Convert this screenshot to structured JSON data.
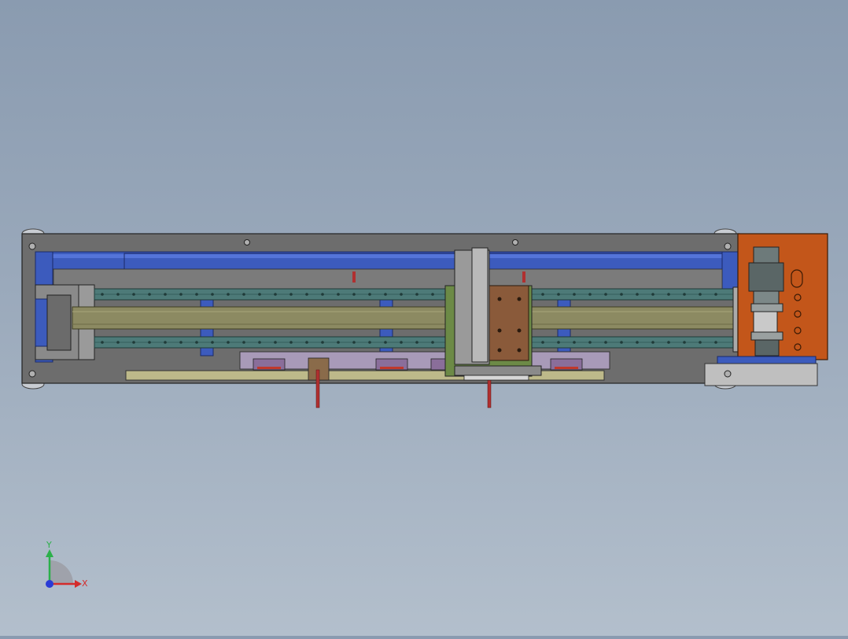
{
  "app": {
    "view": "cad-3d-assembly-front-view"
  },
  "colors": {
    "background_top": "#8a9bb0",
    "background_bottom": "#b3bfcc",
    "frame": "#6c6c6c",
    "frame_inner": "#7a7a7a",
    "blue_profile": "#3c5bbd",
    "rail": "#4d7a78",
    "belt": "#8c8a62",
    "carriage": "#8a5a3a",
    "motor_plate": "#c3561a",
    "red_part": "#c0392b",
    "axis_x": "#d42b2b",
    "axis_y": "#2bb04a",
    "axis_z": "#2a3bd6"
  },
  "triad": {
    "x_label": "X",
    "y_label": "Y"
  }
}
